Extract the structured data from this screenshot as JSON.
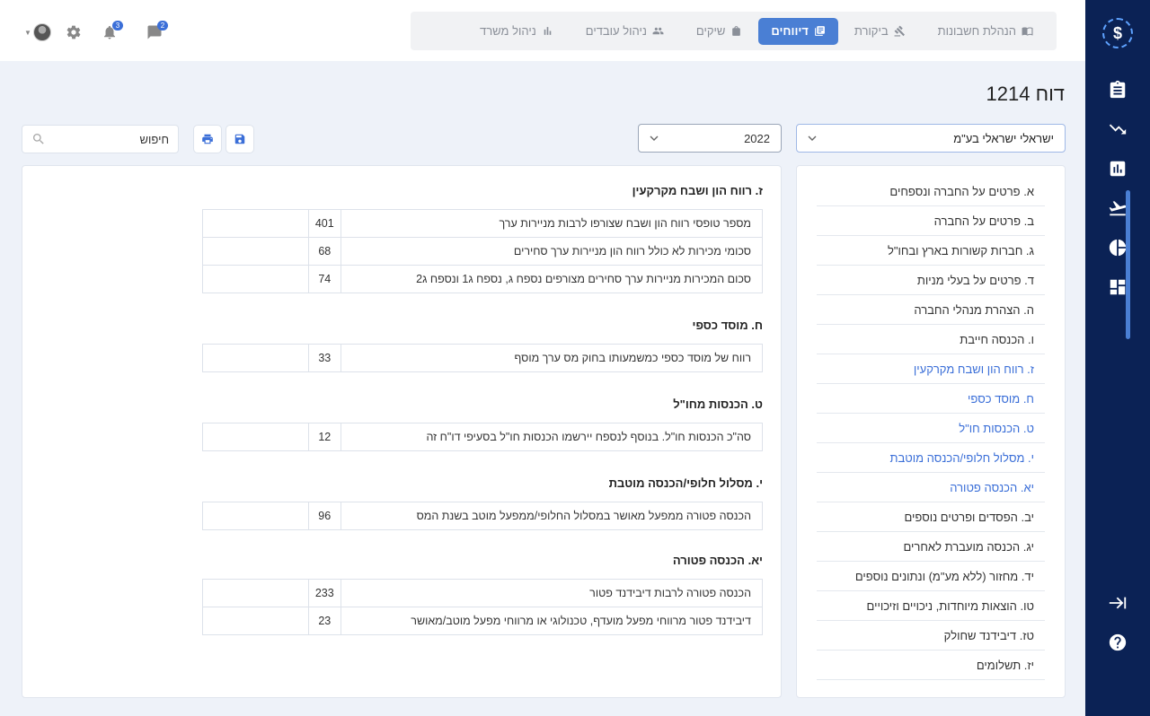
{
  "rail": {
    "logo": "$",
    "icons": [
      "clipboard-icon",
      "trend-down-icon",
      "bar-chart-icon",
      "plane-depart-icon",
      "pie-chart-icon",
      "dashboard-icon"
    ],
    "bottom_icons": [
      "collapse-arrow-icon",
      "help-icon"
    ]
  },
  "nav": {
    "items": [
      {
        "label": "הנהלת חשבונות",
        "icon": "book-icon",
        "active": false
      },
      {
        "label": "ביקורת",
        "icon": "gavel-icon",
        "active": false
      },
      {
        "label": "דיווחים",
        "icon": "newspaper-icon",
        "active": true
      },
      {
        "label": "שיקים",
        "icon": "bag-icon",
        "active": false
      },
      {
        "label": "ניהול עובדים",
        "icon": "users-icon",
        "active": false
      },
      {
        "label": "ניהול משרד",
        "icon": "bar-chart-icon",
        "active": false
      }
    ]
  },
  "topbar": {
    "messages_badge": "2",
    "notifications_badge": "3"
  },
  "page": {
    "title": "דוח 1214"
  },
  "filters": {
    "company": "ישראלי ישראלי בע\"מ",
    "year": "2022",
    "search_placeholder": "חיפוש"
  },
  "toc": {
    "items": [
      {
        "label": "א. פרטים על החברה ונספחים",
        "active": false
      },
      {
        "label": "ב. פרטים על החברה",
        "active": false
      },
      {
        "label": "ג. חברות קשורות בארץ ובחו\"ל",
        "active": false
      },
      {
        "label": "ד. פרטים על בעלי מניות",
        "active": false
      },
      {
        "label": "ה. הצהרת מנהלי החברה",
        "active": false
      },
      {
        "label": "ו. הכנסה חייבת",
        "active": false
      },
      {
        "label": "ז. רווח הון ושבח מקרקעין",
        "active": true
      },
      {
        "label": "ח. מוסד כספי",
        "active": true
      },
      {
        "label": "ט. הכנסות חו\"ל",
        "active": true
      },
      {
        "label": "י. מסלול חלופי/הכנסה מוטבת",
        "active": true
      },
      {
        "label": "יא. הכנסה פטורה",
        "active": true
      },
      {
        "label": "יב. הפסדים ופרטים נוספים",
        "active": false
      },
      {
        "label": "יג. הכנסה מועברת לאחרים",
        "active": false
      },
      {
        "label": "יד. מחזור (ללא מע\"מ) ונתונים נוספים",
        "active": false
      },
      {
        "label": "טו. הוצאות מיוחדות, ניכויים וזיכויים",
        "active": false
      },
      {
        "label": "טז. דיבידנד שחולק",
        "active": false
      },
      {
        "label": "יז. תשלומים",
        "active": false
      }
    ]
  },
  "sections": [
    {
      "title": "ז. רווח הון ושבח מקרקעין",
      "rows": [
        {
          "label": "מספר טופסי רווח הון ושבח שצורפו לרבות מניירות ערך",
          "value": "401"
        },
        {
          "label": "סכומי מכירות לא כולל רווח הון מניירות ערך סחירים",
          "value": "68"
        },
        {
          "label": "סכום המכירות מניירות ערך סחירים מצורפים נספח ג, נספח ג1 ונספח ג2",
          "value": "74"
        }
      ]
    },
    {
      "title": "ח. מוסד כספי",
      "rows": [
        {
          "label": "רווח של מוסד כספי כמשמעותו בחוק מס ערך מוסף",
          "value": "33"
        }
      ]
    },
    {
      "title": "ט. הכנסות מחו\"ל",
      "rows": [
        {
          "label": "סה\"כ הכנסות חו\"ל. בנוסף לנספח יירשמו הכנסות חו\"ל בסעיפי דו\"ח זה",
          "value": "12"
        }
      ]
    },
    {
      "title": "י. מסלול חלופי/הכנסה מוטבת",
      "rows": [
        {
          "label": "הכנסה פטורה ממפעל מאושר במסלול החלופי/ממפעל מוטב בשנת המס",
          "value": "96"
        }
      ]
    },
    {
      "title": "יא. הכנסה פטורה",
      "rows": [
        {
          "label": "הכנסה פטורה לרבות דיבידנד פטור",
          "value": "233"
        },
        {
          "label": "דיבידנד פטור מרווחי מפעל מועדף, טכנולוגי או מרווחי מפעל מוטב/מאושר",
          "value": "23"
        }
      ]
    }
  ]
}
